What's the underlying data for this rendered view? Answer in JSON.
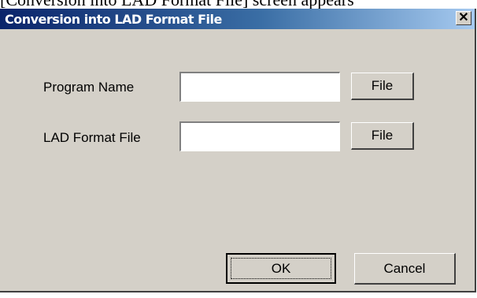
{
  "caption": "[Conversion into LAD Format File] screen appears",
  "dialog": {
    "title": "Conversion into LAD Format File",
    "close_glyph": "✕"
  },
  "fields": [
    {
      "label": "Program Name",
      "value": "",
      "button_label": "File"
    },
    {
      "label": "LAD Format File",
      "value": "",
      "button_label": "File"
    }
  ],
  "buttons": {
    "ok_label": "OK",
    "cancel_label": "Cancel"
  }
}
